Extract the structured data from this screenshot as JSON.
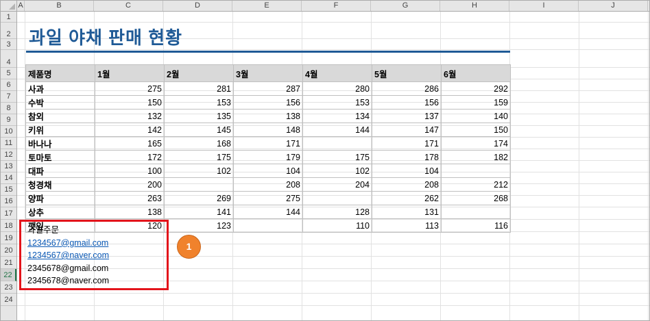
{
  "columns": [
    "A",
    "B",
    "C",
    "D",
    "E",
    "F",
    "G",
    "H",
    "I",
    "J"
  ],
  "rows": [
    "1",
    "2",
    "3",
    "4",
    "5",
    "6",
    "7",
    "8",
    "9",
    "10",
    "11",
    "12",
    "13",
    "14",
    "15",
    "16",
    "17",
    "18",
    "19",
    "20",
    "21",
    "22",
    "23",
    "24"
  ],
  "selected_row": "22",
  "title": "과일 야채 판매 현황",
  "table": {
    "headers": [
      "제품명",
      "1월",
      "2월",
      "3월",
      "4월",
      "5월",
      "6월"
    ],
    "rows": [
      [
        "사과",
        "275",
        "281",
        "287",
        "280",
        "286",
        "292"
      ],
      [
        "수박",
        "150",
        "153",
        "156",
        "153",
        "156",
        "159"
      ],
      [
        "참외",
        "132",
        "135",
        "138",
        "134",
        "137",
        "140"
      ],
      [
        "키위",
        "142",
        "145",
        "148",
        "144",
        "147",
        "150"
      ],
      [
        "바나나",
        "165",
        "168",
        "171",
        "",
        "171",
        "174"
      ],
      [
        "토마토",
        "172",
        "175",
        "179",
        "175",
        "178",
        "182"
      ],
      [
        "대파",
        "100",
        "102",
        "104",
        "102",
        "104",
        ""
      ],
      [
        "청경채",
        "200",
        "",
        "208",
        "204",
        "208",
        "212"
      ],
      [
        "양파",
        "263",
        "269",
        "275",
        "",
        "262",
        "268"
      ],
      [
        "상추",
        "138",
        "141",
        "144",
        "128",
        "131",
        ""
      ],
      [
        "깻잎",
        "120",
        "123",
        "",
        "110",
        "113",
        "116"
      ]
    ]
  },
  "notes": {
    "heading": "과일주문",
    "emails": [
      {
        "text": "1234567@gmail.com",
        "link": true
      },
      {
        "text": "1234567@naver.com",
        "link": true
      },
      {
        "text": "2345678@gmail.com",
        "link": false
      },
      {
        "text": "2345678@naver.com",
        "link": false
      }
    ]
  },
  "badge": "1",
  "colors": {
    "title": "#1f5a96",
    "highlight_box": "#e3141b",
    "badge": "#f0822c",
    "link": "#0b59b5"
  }
}
